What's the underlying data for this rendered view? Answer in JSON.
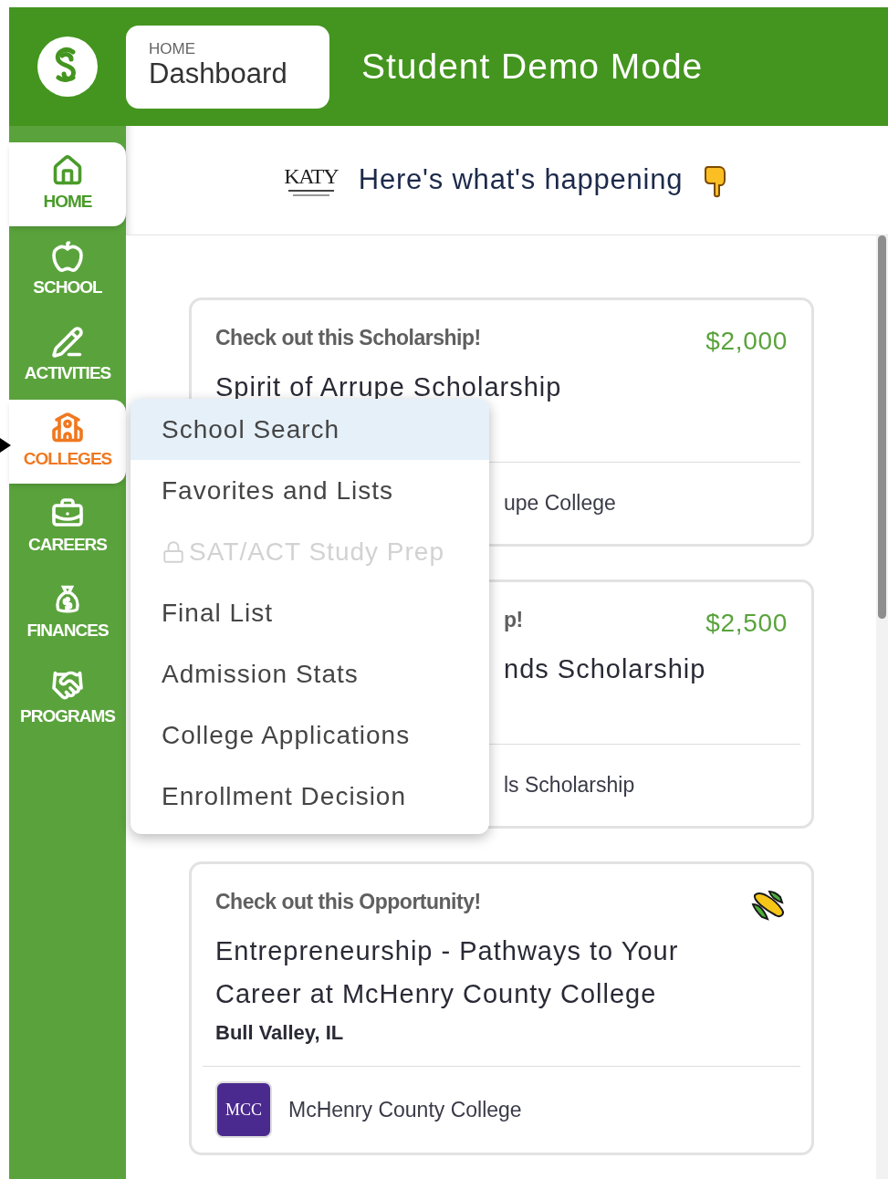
{
  "header": {
    "breadcrumb": {
      "section": "HOME",
      "page": "Dashboard"
    },
    "title": "Student Demo Mode"
  },
  "sidebar": {
    "items": [
      {
        "kind": "home",
        "label": "HOME",
        "selected": true,
        "open": false
      },
      {
        "kind": "school",
        "label": "SCHOOL",
        "selected": false,
        "open": false
      },
      {
        "kind": "activities",
        "label": "ACTIVITIES",
        "selected": false,
        "open": false
      },
      {
        "kind": "colleges",
        "label": "COLLEGES",
        "selected": false,
        "open": true
      },
      {
        "kind": "careers",
        "label": "CAREERS",
        "selected": false,
        "open": false
      },
      {
        "kind": "finances",
        "label": "FINANCES",
        "selected": false,
        "open": false
      },
      {
        "kind": "programs",
        "label": "PROGRAMS",
        "selected": false,
        "open": false
      }
    ]
  },
  "feed": {
    "logo_text": "KATY",
    "heading": "Here's what's happening",
    "cards": [
      {
        "kind": "scholarship",
        "eyebrow": {
          "text": "Check out this Scholarship!",
          "clipped": false
        },
        "amount": "$2,000",
        "title": {
          "text": "Spirit of Arrupe Scholarship",
          "clipped": false
        },
        "footer": "upe College"
      },
      {
        "kind": "scholarship",
        "eyebrow": {
          "text": "p!",
          "clipped": true
        },
        "amount": "$2,500",
        "title": {
          "text": "nds Scholarship",
          "clipped": true
        },
        "footer": "ls Scholarship"
      },
      {
        "kind": "opportunity",
        "eyebrow": {
          "text": "Check out this Opportunity!",
          "clipped": false
        },
        "title": {
          "text": "Entrepreneurship - Pathways to Your Career at McHenry County College",
          "clipped": false
        },
        "location": "Bull Valley, IL",
        "logo_text": "MCC",
        "footer": "McHenry County College"
      }
    ]
  },
  "menu": {
    "items": [
      {
        "label": "School Search",
        "selected": true,
        "disabled": false
      },
      {
        "label": "Favorites and Lists",
        "selected": false,
        "disabled": false
      },
      {
        "label": "SAT/ACT Study Prep",
        "selected": false,
        "disabled": true
      },
      {
        "label": "Final List",
        "selected": false,
        "disabled": false
      },
      {
        "label": "Admission Stats",
        "selected": false,
        "disabled": false
      },
      {
        "label": "College Applications",
        "selected": false,
        "disabled": false
      },
      {
        "label": "Enrollment Decision",
        "selected": false,
        "disabled": false
      }
    ]
  }
}
